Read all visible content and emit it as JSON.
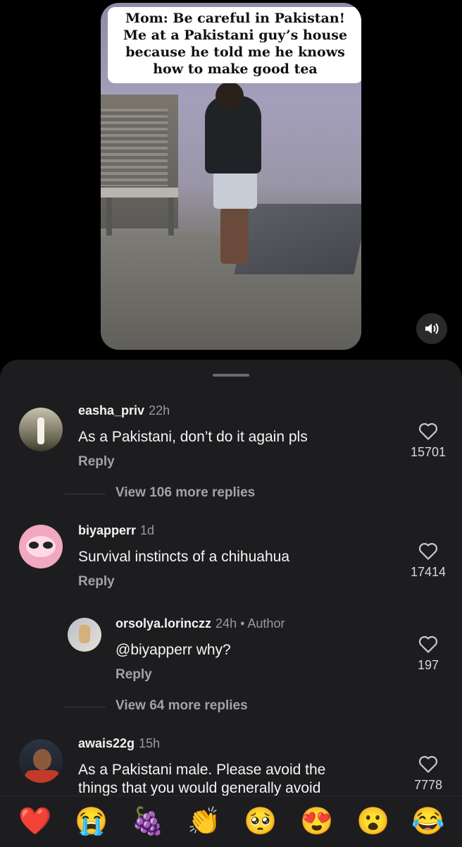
{
  "video": {
    "caption_lines": [
      "Mom: Be careful in Pakistan!",
      "Me at a Pakistani guy’s house",
      "because he told me he knows",
      "how to make good tea"
    ]
  },
  "comments": [
    {
      "username": "easha_priv",
      "time": "22h",
      "text": "As a Pakistani, don’t do it again pls",
      "reply_label": "Reply",
      "likes": "15701",
      "view_more": "View 106 more replies"
    },
    {
      "username": "biyapperr",
      "time": "1d",
      "text": "Survival instincts of a chihuahua",
      "reply_label": "Reply",
      "likes": "17414"
    },
    {
      "username": "orsolya.lorinczz",
      "time": "24h",
      "author_tag": "• Author",
      "mention": "@biyapperr",
      "text": " why?",
      "reply_label": "Reply",
      "likes": "197",
      "view_more": "View 64 more replies"
    },
    {
      "username": "awais22g",
      "time": "15h",
      "text_line1": "As a Pakistani male. Please avoid the",
      "text_line2": "things that you would generally avoid",
      "likes": "7778"
    }
  ],
  "emoji_bar": [
    "❤️",
    "😭",
    "🍇",
    "👏",
    "🥺",
    "😍",
    "😮",
    "😂"
  ],
  "colors": {
    "sheet_bg": "#1d1d20",
    "muted": "#9a9a9e",
    "heart": "#ff3b5c"
  }
}
